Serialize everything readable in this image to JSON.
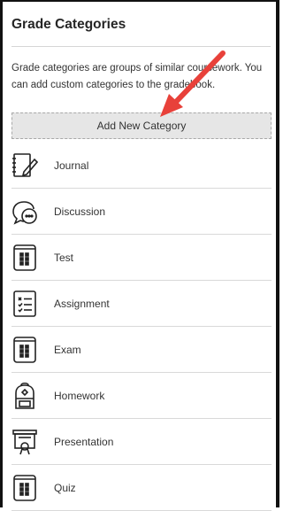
{
  "panel": {
    "title": "Grade Categories",
    "description": "Grade categories are groups of similar coursework. You can add custom categories to the gradebook.",
    "add_button_label": "Add New Category"
  },
  "categories": [
    {
      "label": "Journal",
      "icon": "journal-icon"
    },
    {
      "label": "Discussion",
      "icon": "discussion-icon"
    },
    {
      "label": "Test",
      "icon": "test-icon"
    },
    {
      "label": "Assignment",
      "icon": "assignment-icon"
    },
    {
      "label": "Exam",
      "icon": "exam-icon"
    },
    {
      "label": "Homework",
      "icon": "homework-icon"
    },
    {
      "label": "Presentation",
      "icon": "presentation-icon"
    },
    {
      "label": "Quiz",
      "icon": "quiz-icon"
    }
  ],
  "colors": {
    "annotation_arrow": "#e8413a",
    "button_bg": "#e6e6e6",
    "divider": "#d9d9d9"
  }
}
